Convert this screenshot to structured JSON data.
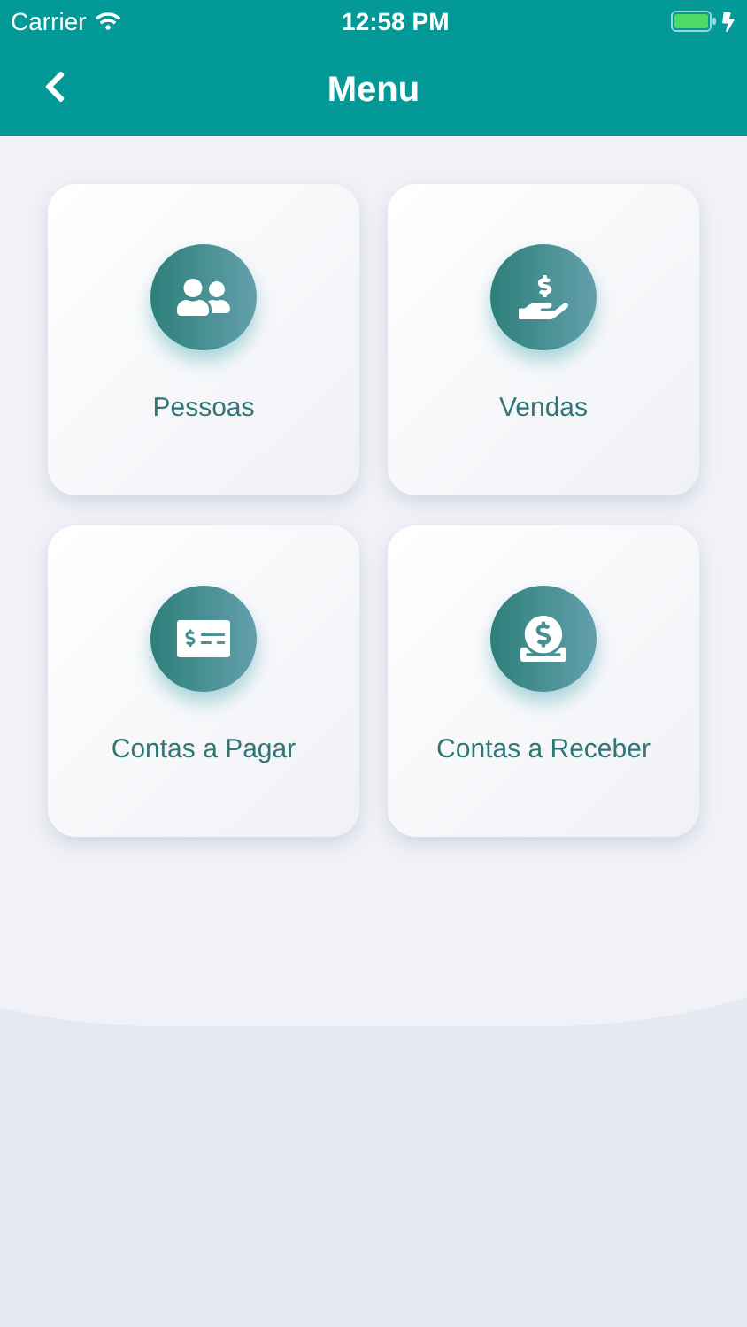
{
  "status_bar": {
    "carrier": "Carrier",
    "time": "12:58 PM"
  },
  "header": {
    "title": "Menu"
  },
  "menu_items": [
    {
      "label": "Pessoas",
      "kind": "people"
    },
    {
      "label": "Vendas",
      "kind": "sales"
    },
    {
      "label": "Contas a Pagar",
      "kind": "payables"
    },
    {
      "label": "Contas a Receber",
      "kind": "receivables"
    }
  ]
}
